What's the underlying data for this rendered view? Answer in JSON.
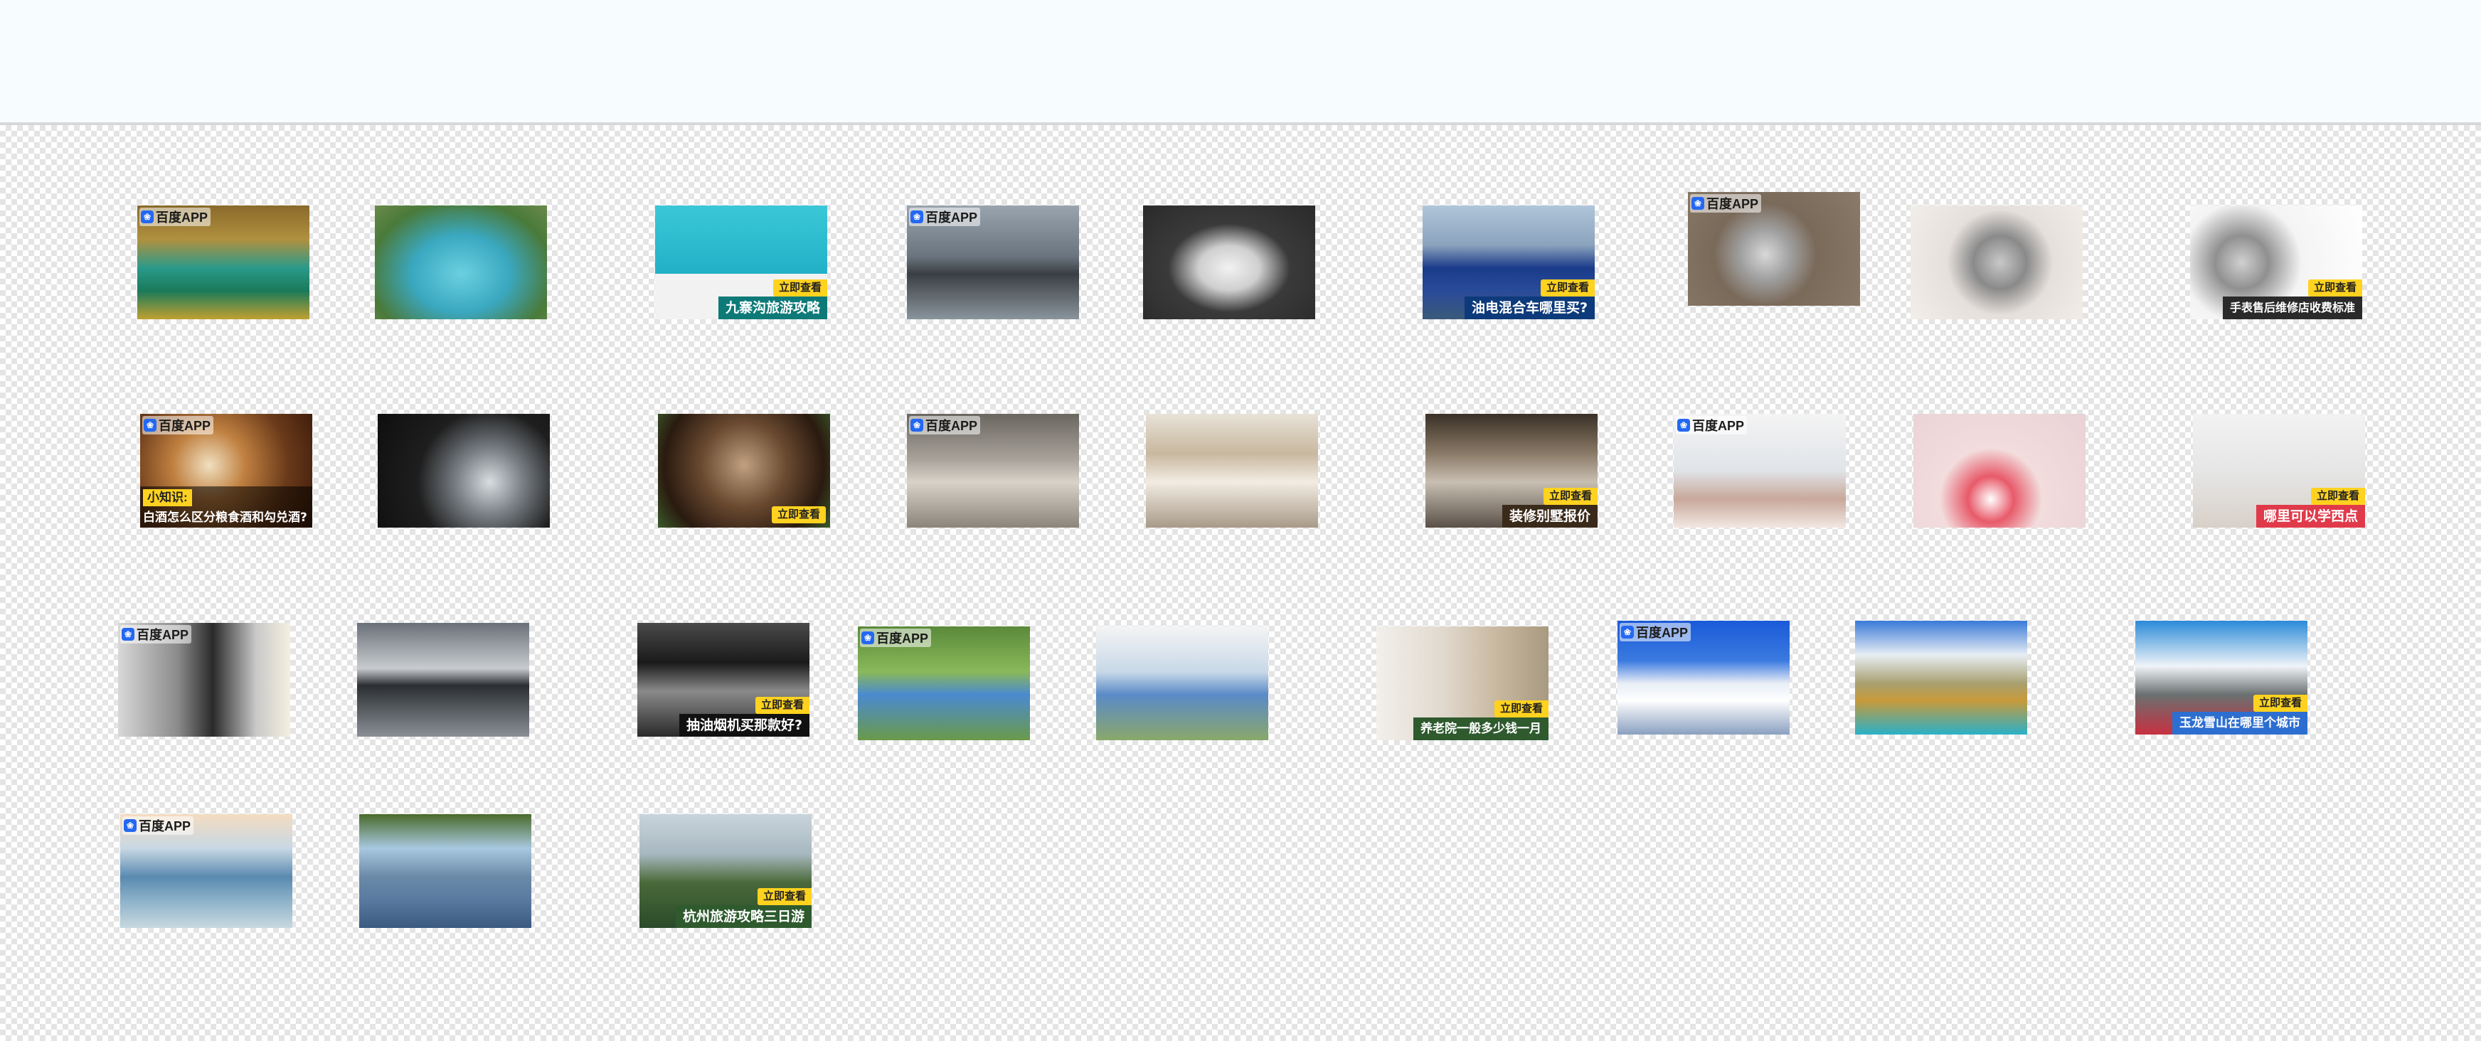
{
  "colors": {
    "cta": "#ffd21f",
    "brand": "#2468f2"
  },
  "badge": "百度APP",
  "cta": "立即查看",
  "thumbs": [
    {
      "name": "jiuzhaigou-lake-app",
      "badge": true
    },
    {
      "name": "jiuzhaigou-terraces"
    },
    {
      "name": "jiuzhaigou-guide",
      "cta": true,
      "caption": "九寨沟旅游攻略"
    },
    {
      "name": "car-offroad-app",
      "badge": true
    },
    {
      "name": "car-white-suv"
    },
    {
      "name": "car-blue-hybrid",
      "cta": true,
      "caption": "油电混合车哪里买?"
    },
    {
      "name": "watch-repair-app",
      "badge": true
    },
    {
      "name": "watch-movement"
    },
    {
      "name": "watch-service",
      "cta": true,
      "caption": "手表售后维修店收费标准"
    },
    {
      "name": "liquor-tip-app",
      "badge": true,
      "tip": "小知识:",
      "question": "白酒怎么区分粮食酒和勾兑酒?"
    },
    {
      "name": "liquor-teapot"
    },
    {
      "name": "liquor-cheers",
      "cta": true
    },
    {
      "name": "villa-living-app",
      "badge": true
    },
    {
      "name": "villa-hall"
    },
    {
      "name": "villa-price",
      "cta": true,
      "caption": "装修别墅报价"
    },
    {
      "name": "pastry-class-app",
      "badge": true
    },
    {
      "name": "pastry-cake"
    },
    {
      "name": "pastry-learn",
      "cta": true,
      "caption": "哪里可以学西点"
    },
    {
      "name": "range-hood-app",
      "badge": true
    },
    {
      "name": "range-hood-steel"
    },
    {
      "name": "range-hood-buy",
      "cta": true,
      "caption": "抽油烟机买那款好?"
    },
    {
      "name": "elder-care-app",
      "badge": true
    },
    {
      "name": "elder-wheelchair"
    },
    {
      "name": "nursing-home-price",
      "cta": true,
      "caption": "养老院一般多少钱一月"
    },
    {
      "name": "snow-mountain-app",
      "badge": true
    },
    {
      "name": "snow-mountain-lake"
    },
    {
      "name": "snow-mountain-city",
      "cta": true,
      "caption": "玉龙雪山在哪里个城市"
    },
    {
      "name": "hangzhou-pagoda-app",
      "badge": true
    },
    {
      "name": "hangzhou-pavilion"
    },
    {
      "name": "hangzhou-trip",
      "cta": true,
      "caption": "杭州旅游攻略三日游"
    }
  ]
}
